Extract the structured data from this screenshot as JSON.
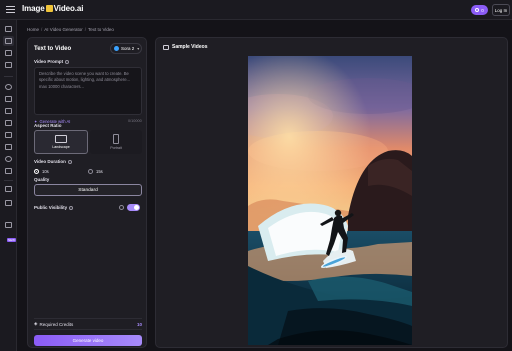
{
  "brand": {
    "name_left": "Image",
    "name_right": "Video.ai"
  },
  "header": {
    "credits_value": "0",
    "login_label": "Log In"
  },
  "sidebar": {
    "new_badge": "NEW"
  },
  "breadcrumb": [
    "Home",
    "AI Video Generator",
    "Text to Video"
  ],
  "left_panel": {
    "title": "Text to Video",
    "model": "Sora 2",
    "prompt_label": "Video Prompt",
    "prompt_placeholder": "Describe the video scene you want to create. Be specific about motion, lighting, and atmosphere... max 10000 characters...",
    "generate_ai_label": "Generate with AI",
    "char_count": "0/10000",
    "aspect_ratio_label": "Aspect Ratio",
    "aspect_options": [
      {
        "label": "Landscape",
        "selected": true
      },
      {
        "label": "Portrait",
        "selected": false
      }
    ],
    "duration_label": "Video Duration",
    "duration_options": [
      {
        "label": "10s",
        "selected": true
      },
      {
        "label": "15s",
        "selected": false
      }
    ],
    "quality_label": "Quality",
    "quality_value": "Standard",
    "visibility_label": "Public Visibility",
    "visibility_on": true,
    "required_credits_label": "Required Credits",
    "required_credits_value": "10",
    "generate_button": "Generate video"
  },
  "right_panel": {
    "title": "Sample Videos"
  },
  "colors": {
    "accent": "#8b5cf6",
    "accent_light": "#a78bfa",
    "bg": "#141318",
    "panel": "#1f1e24",
    "brand_mark": "#f0c43a"
  }
}
